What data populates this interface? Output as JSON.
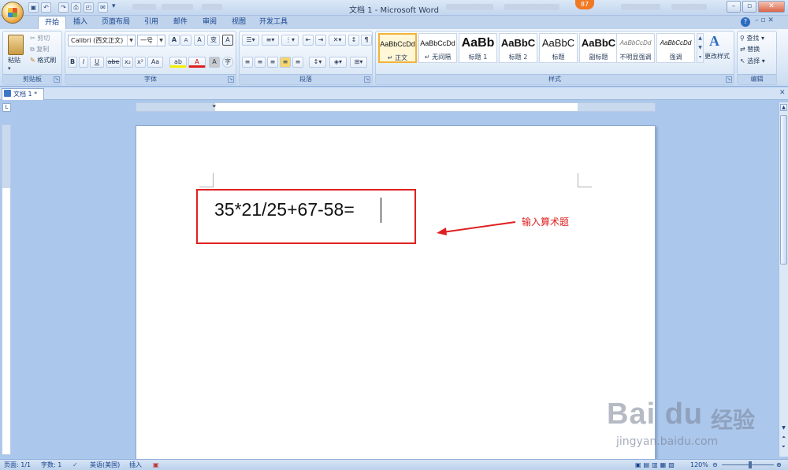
{
  "window": {
    "title": "文档 1 - Microsoft Word",
    "badge": "87",
    "controls": {
      "minimize": "–",
      "restore": "▫",
      "close": "✕"
    }
  },
  "quick_access": [
    "save-icon",
    "undo-icon",
    "redo-icon",
    "print-icon",
    "preview-icon"
  ],
  "tabs": [
    {
      "label": "开始",
      "active": true
    },
    {
      "label": "插入"
    },
    {
      "label": "页面布局"
    },
    {
      "label": "引用"
    },
    {
      "label": "邮件"
    },
    {
      "label": "审阅"
    },
    {
      "label": "视图"
    },
    {
      "label": "开发工具"
    }
  ],
  "ribbon": {
    "clipboard": {
      "title": "剪贴板",
      "paste": "粘贴",
      "cut": "剪切",
      "copy": "复制",
      "painter": "格式刷"
    },
    "font": {
      "title": "字体",
      "font_name": "Calibri (西文正文)",
      "font_size": "一号",
      "grow": "A",
      "shrink": "A",
      "clear": "A",
      "phonetic": "变",
      "border_char": "A",
      "bold": "B",
      "italic": "I",
      "underline": "U",
      "strike": "abe",
      "subscript": "x₂",
      "superscript": "x²",
      "case": "Aa",
      "highlight": "ab",
      "color": "A",
      "shade": "A",
      "enclose": "字"
    },
    "paragraph": {
      "title": "段落"
    },
    "styles": {
      "title": "样式",
      "items": [
        {
          "sample": "AaBbCcDd",
          "name": "↵ 正文"
        },
        {
          "sample": "AaBbCcDd",
          "name": "↵ 无间隔"
        },
        {
          "sample": "AaBb",
          "name": "标题 1"
        },
        {
          "sample": "AaBbC",
          "name": "标题 2"
        },
        {
          "sample": "AaBbC",
          "name": "标题"
        },
        {
          "sample": "AaBbC",
          "name": "副标题"
        },
        {
          "sample": "AaBbCcDd",
          "name": "不明显强调"
        },
        {
          "sample": "AaBbCcDd",
          "name": "强调"
        }
      ],
      "change": "更改样式"
    },
    "editing": {
      "title": "编辑",
      "find": "查找",
      "replace": "替换",
      "select": "选择"
    }
  },
  "document": {
    "tab": "文档 1 *",
    "content": "35*21/25+67-58=",
    "annotation": "输入算术题"
  },
  "status": {
    "page": "页面: 1/1",
    "words": "字数: 1",
    "language": "英语(美国)",
    "mode": "插入",
    "zoom": "120%"
  },
  "watermark": {
    "logo": "Bai du",
    "cn": "经验",
    "url": "jingyan.baidu.com"
  },
  "colors": {
    "annotation": "#e02020",
    "ribbon": "#dde9f7",
    "highlight_style": "#f2b23a"
  }
}
